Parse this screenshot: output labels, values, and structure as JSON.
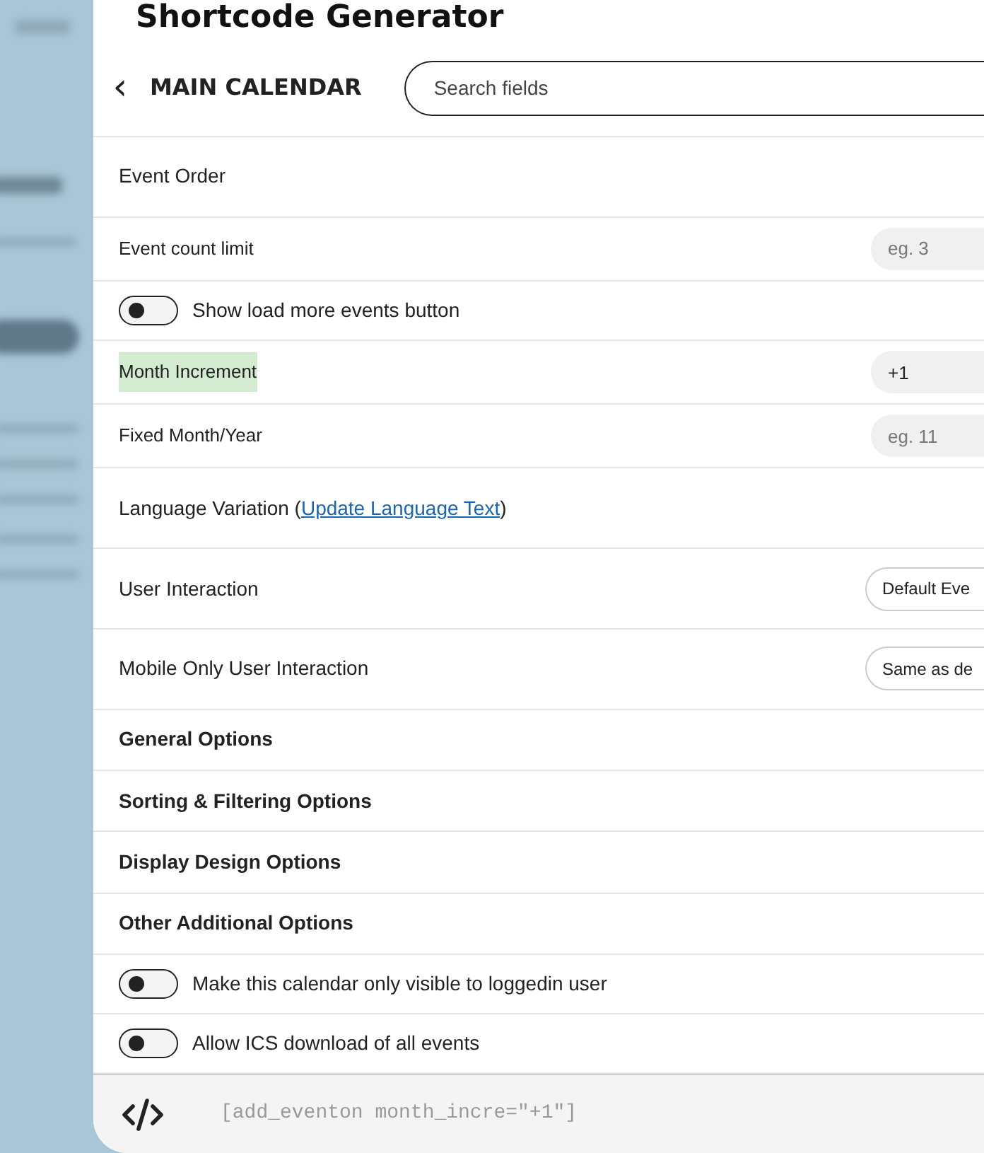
{
  "title": "Shortcode Generator",
  "header": {
    "back": "‹",
    "section": "MAIN CALENDAR",
    "search": {
      "placeholder": "Search fields"
    }
  },
  "rows": [
    {
      "kind": "plain",
      "label": "Event Order"
    },
    {
      "kind": "input",
      "label": "Event count limit",
      "placeholder": "eg. 3",
      "highlighted": false
    },
    {
      "kind": "toggle",
      "label": "Show load more events button",
      "on": false
    },
    {
      "kind": "input",
      "label": "Month Increment",
      "value": "+1",
      "highlighted": true
    },
    {
      "kind": "input",
      "label": "Fixed Month/Year",
      "placeholder": "eg. 11",
      "highlighted": false
    },
    {
      "kind": "link",
      "label": "Language Variation (",
      "link": "Update Language Text",
      "after": ")"
    },
    {
      "kind": "select",
      "label": "User Interaction",
      "value": "Default Eve"
    },
    {
      "kind": "select",
      "label": "Mobile Only User Interaction",
      "value": "Same as de"
    },
    {
      "kind": "heading",
      "label": "General Options"
    },
    {
      "kind": "heading",
      "label": "Sorting & Filtering Options"
    },
    {
      "kind": "heading",
      "label": "Display Design Options"
    },
    {
      "kind": "heading",
      "label": "Other Additional Options"
    },
    {
      "kind": "toggle",
      "label": "Make this calendar only visible to loggedin user",
      "on": false
    },
    {
      "kind": "toggle",
      "label": "Allow ICS download of all events",
      "on": false
    }
  ],
  "footer": {
    "shortcode": "[add_eventon month_incre=\"+1\"]"
  }
}
